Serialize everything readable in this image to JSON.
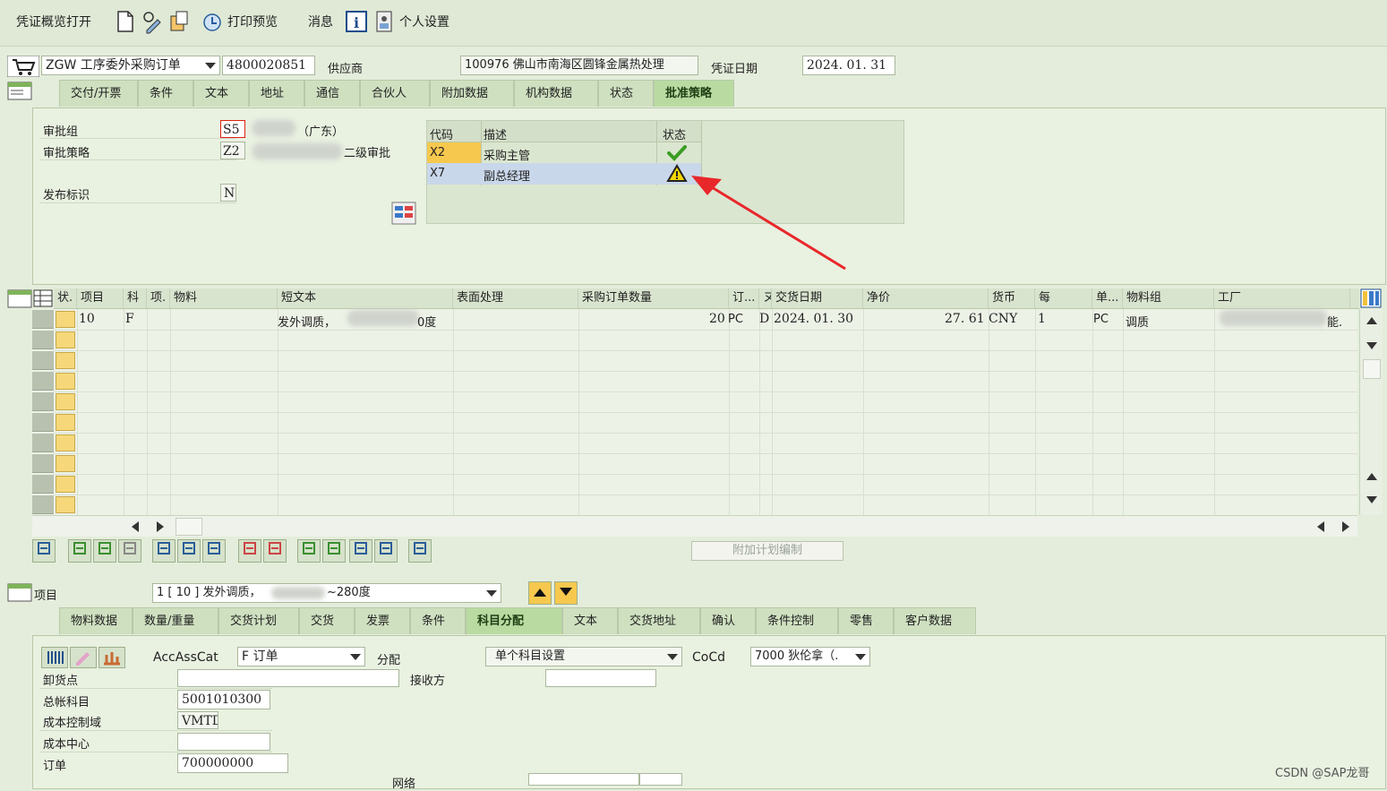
{
  "toolbar": {
    "overview": "凭证概览打开",
    "print_preview": "打印预览",
    "messages": "消息",
    "personal_settings": "个人设置"
  },
  "header": {
    "doc_type": "ZGW 工序委外采购订单",
    "po_number": "4800020851",
    "vendor_label": "供应商",
    "vendor_value": "100976 佛山市南海区圆锋金属热处理",
    "doc_date_label": "凭证日期",
    "doc_date": "2024. 01. 31"
  },
  "header_tabs": [
    "交付/开票",
    "条件",
    "文本",
    "地址",
    "通信",
    "合伙人",
    "附加数据",
    "机构数据",
    "状态",
    "批准策略"
  ],
  "approval": {
    "group_label": "审批组",
    "group_value": "S5",
    "group_desc": "（广东）",
    "strategy_label": "审批策略",
    "strategy_value": "Z2",
    "strategy_desc": "二级审批",
    "release_label": "发布标识",
    "release_value": "N",
    "table_headers": [
      "代码",
      "描述",
      "状态"
    ],
    "rows": [
      {
        "code": "X2",
        "desc": "采购主管",
        "status": "check"
      },
      {
        "code": "X7",
        "desc": "副总经理",
        "status": "warning"
      }
    ]
  },
  "items_grid": {
    "headers": [
      "状.",
      "项目",
      "科",
      "项.",
      "物料",
      "短文本",
      "表面处理",
      "采购订单数量",
      "订...",
      "ヌ",
      "交货日期",
      "净价",
      "货币",
      "每",
      "单...",
      "物料组",
      "工厂"
    ],
    "row": {
      "item": "10",
      "acc": "F",
      "short_text_a": "发外调质，",
      "short_text_b": "0度",
      "qty": "20",
      "unit": "PC",
      "cat": "D",
      "delivery": "2024. 01. 30",
      "price": "27. 61",
      "currency": "CNY",
      "per": "1",
      "uom": "PC",
      "mat_group": "调质",
      "plant_tail": "能."
    },
    "plan_button": "附加计划编制"
  },
  "item_detail": {
    "label": "项目",
    "selector": "1 [ 10 ] 发外调质，",
    "selector_tail": "~280度",
    "tabs": [
      "物料数据",
      "数量/重量",
      "交货计划",
      "交货",
      "发票",
      "条件",
      "科目分配",
      "文本",
      "交货地址",
      "确认",
      "条件控制",
      "零售",
      "客户数据"
    ],
    "accasscat_label": "AccAssCat",
    "accasscat_value": "F 订单",
    "distribution_label": "分配",
    "distribution_value": "单个科目设置",
    "cocd_label": "CoCd",
    "cocd_value": "7000 狄伦拿（.",
    "unloading_label": "卸货点",
    "recipient_label": "接收方",
    "gl_label": "总帐科目",
    "gl_value": "5001010300",
    "co_area_label": "成本控制域",
    "co_area_value": "VMTD",
    "cost_center_label": "成本中心",
    "order_label": "订单",
    "order_value": "700000000",
    "network_label": "网络"
  },
  "watermark": "CSDN @SAP龙哥",
  "colors": {
    "accent_tab": "#b9dba1",
    "warning": "#f2d600",
    "check": "#3a9d23",
    "arrow": "#e8272b"
  }
}
